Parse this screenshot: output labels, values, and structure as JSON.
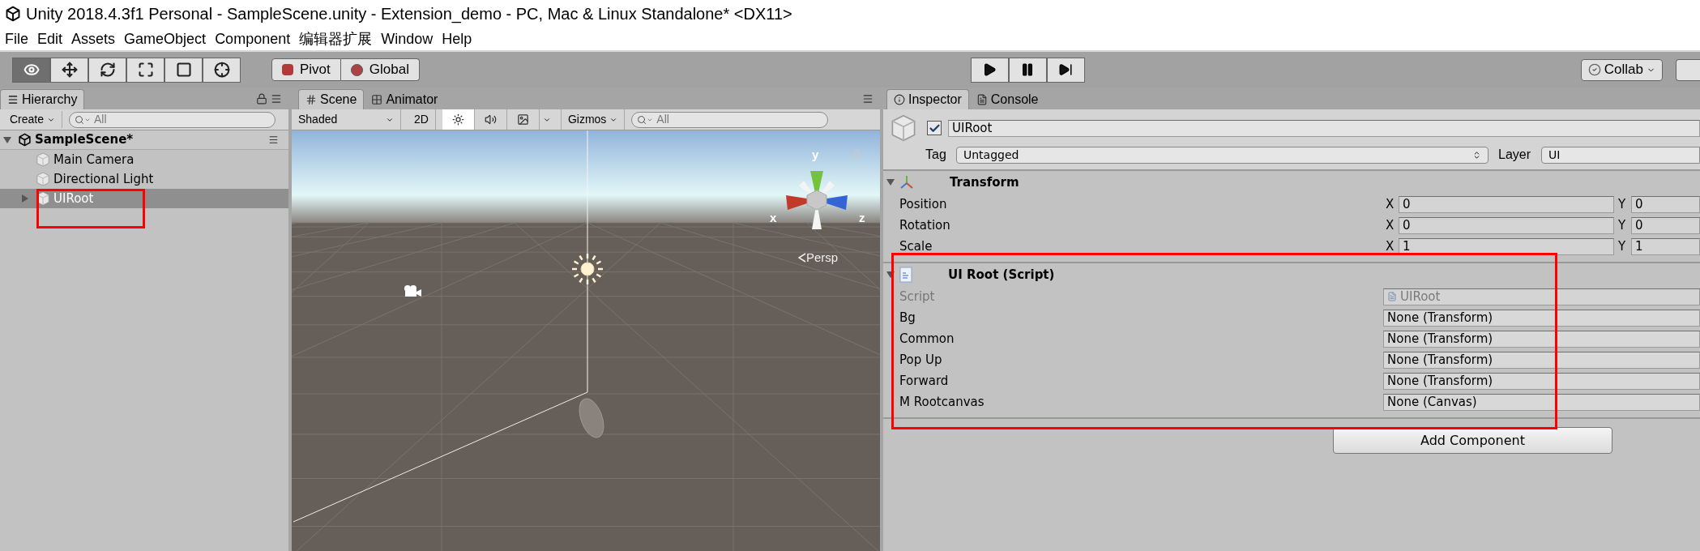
{
  "window": {
    "title": "Unity 2018.4.3f1 Personal - SampleScene.unity - Extension_demo - PC, Mac & Linux Standalone* <DX11>"
  },
  "menu": [
    "File",
    "Edit",
    "Assets",
    "GameObject",
    "Component",
    "编辑器扩展",
    "Window",
    "Help"
  ],
  "toolbar": {
    "tools": [
      {
        "kind": "view",
        "selected": true
      },
      {
        "kind": "move",
        "selected": false
      },
      {
        "kind": "rotate",
        "selected": false
      },
      {
        "kind": "scale",
        "selected": false
      },
      {
        "kind": "rect",
        "selected": false
      },
      {
        "kind": "transform",
        "selected": false
      }
    ],
    "pivot": "Pivot",
    "space": "Global",
    "playback": [
      {
        "kind": "play"
      },
      {
        "kind": "pause"
      },
      {
        "kind": "step"
      }
    ],
    "collab": "Collab"
  },
  "hierarchy": {
    "tab": "Hierarchy",
    "create": "Create",
    "search": {
      "placeholder": "All"
    },
    "scene": {
      "name": "SampleScene*",
      "expanded": true,
      "children": [
        {
          "name": "Main Camera",
          "kind": "leaf",
          "selected": false
        },
        {
          "name": "Directional Light",
          "kind": "leaf",
          "selected": false
        },
        {
          "name": "UIRoot",
          "kind": "collapsed",
          "selected": true
        }
      ]
    }
  },
  "scene_view": {
    "tabs": [
      {
        "label": "Scene",
        "kind": "scene",
        "selected": true
      },
      {
        "label": "Animator",
        "kind": "animator",
        "selected": false
      }
    ],
    "shading": "Shaded",
    "mode_2d": "2D",
    "toggles": [
      {
        "kind": "lighting",
        "on": true
      },
      {
        "kind": "audio",
        "on": false
      },
      {
        "kind": "effects",
        "on": false
      }
    ],
    "gizmos": "Gizmos",
    "search": {
      "placeholder": "All"
    },
    "axes": {
      "y": "y",
      "x": "x",
      "z": "z"
    },
    "projection": "Persp"
  },
  "inspector": {
    "tabs": [
      {
        "label": "Inspector",
        "kind": "inspector",
        "selected": true
      },
      {
        "label": "Console",
        "kind": "console",
        "selected": false
      }
    ],
    "object": {
      "active": true,
      "name": "UIRoot",
      "tag_label": "Tag",
      "tag": "Untagged",
      "layer_label": "Layer",
      "layer": "UI"
    },
    "components": [
      {
        "kind": "transform",
        "title": "Transform",
        "expanded": true,
        "rows": [
          {
            "label": "Position",
            "fields": [
              {
                "axis": "X",
                "value": "0"
              },
              {
                "axis": "Y",
                "value": "0"
              }
            ]
          },
          {
            "label": "Rotation",
            "fields": [
              {
                "axis": "X",
                "value": "0"
              },
              {
                "axis": "Y",
                "value": "0"
              }
            ]
          },
          {
            "label": "Scale",
            "fields": [
              {
                "axis": "X",
                "value": "1"
              },
              {
                "axis": "Y",
                "value": "1"
              }
            ]
          }
        ]
      },
      {
        "kind": "script",
        "title": "UI Root (Script)",
        "expanded": true,
        "rows": [
          {
            "label": "Script",
            "value": "UIRoot",
            "disabled": true
          },
          {
            "label": "Bg",
            "value": "None (Transform)",
            "disabled": false
          },
          {
            "label": "Common",
            "value": "None (Transform)",
            "disabled": false
          },
          {
            "label": "Pop Up",
            "value": "None (Transform)",
            "disabled": false
          },
          {
            "label": "Forward",
            "value": "None (Transform)",
            "disabled": false
          },
          {
            "label": "M Rootcanvas",
            "value": "None (Canvas)",
            "disabled": false
          }
        ]
      }
    ],
    "add_component": "Add Component"
  }
}
